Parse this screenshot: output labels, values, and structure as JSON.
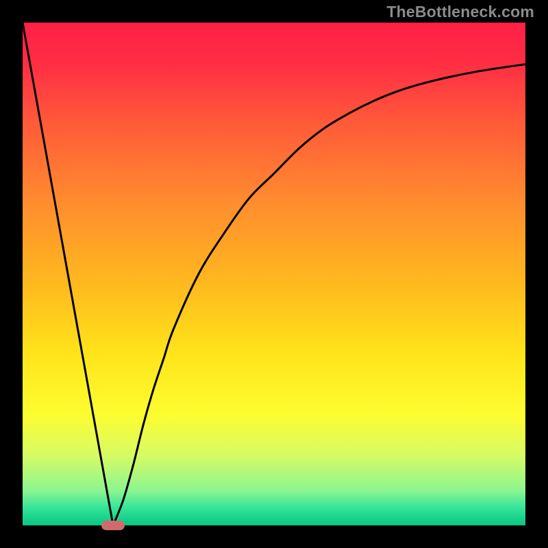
{
  "watermark": "TheBottleneck.com",
  "chart_data": {
    "type": "line",
    "title": "",
    "xlabel": "",
    "ylabel": "",
    "xlim": [
      0,
      100
    ],
    "ylim": [
      0,
      100
    ],
    "grid": false,
    "series": [
      {
        "name": "curve",
        "x": [
          0,
          5,
          10,
          15,
          18,
          20,
          22,
          24,
          26,
          28,
          30,
          35,
          40,
          45,
          50,
          55,
          60,
          65,
          70,
          75,
          80,
          85,
          90,
          95,
          100
        ],
        "values": [
          100,
          72,
          45,
          17,
          0,
          5,
          12,
          20,
          27,
          33,
          39,
          50,
          58,
          65,
          70,
          75,
          79,
          82,
          84.5,
          86.5,
          88,
          89.2,
          90.2,
          91,
          91.7
        ]
      }
    ],
    "highlight": {
      "x": 18,
      "y": 0
    },
    "background_gradient": {
      "stops": [
        {
          "pos": 0.0,
          "color": "#ff2045"
        },
        {
          "pos": 0.08,
          "color": "#ff2d44"
        },
        {
          "pos": 0.2,
          "color": "#ff5a39"
        },
        {
          "pos": 0.35,
          "color": "#ff8a2f"
        },
        {
          "pos": 0.52,
          "color": "#ffb91e"
        },
        {
          "pos": 0.66,
          "color": "#ffe41a"
        },
        {
          "pos": 0.78,
          "color": "#fdfd30"
        },
        {
          "pos": 0.86,
          "color": "#d7fb64"
        },
        {
          "pos": 0.93,
          "color": "#8df58f"
        },
        {
          "pos": 0.965,
          "color": "#35e49a"
        },
        {
          "pos": 1.0,
          "color": "#07c682"
        }
      ]
    }
  }
}
